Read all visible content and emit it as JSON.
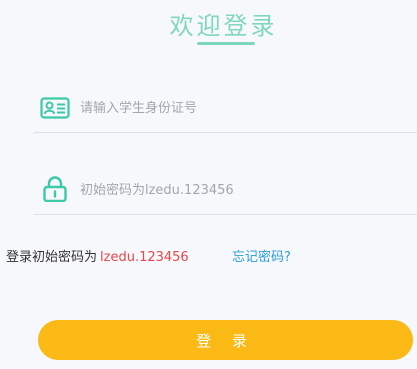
{
  "header": {
    "title": "欢迎登录"
  },
  "form": {
    "id_field": {
      "placeholder": "请输入学生身份证号",
      "value": "",
      "icon": "id-card-icon"
    },
    "password_field": {
      "placeholder": "初始密码为lzedu.123456",
      "value": "",
      "icon": "lock-icon"
    },
    "hint_prefix": "登录初始密码为",
    "hint_password": "lzedu.123456",
    "forgot_link": "忘记密码?",
    "submit_label": "登 录"
  },
  "colors": {
    "accent": "#7fd8bd",
    "icon": "#3cc9a6",
    "button": "#fbb916",
    "hint_red": "#e5484d",
    "link_blue": "#2a9fd6"
  }
}
